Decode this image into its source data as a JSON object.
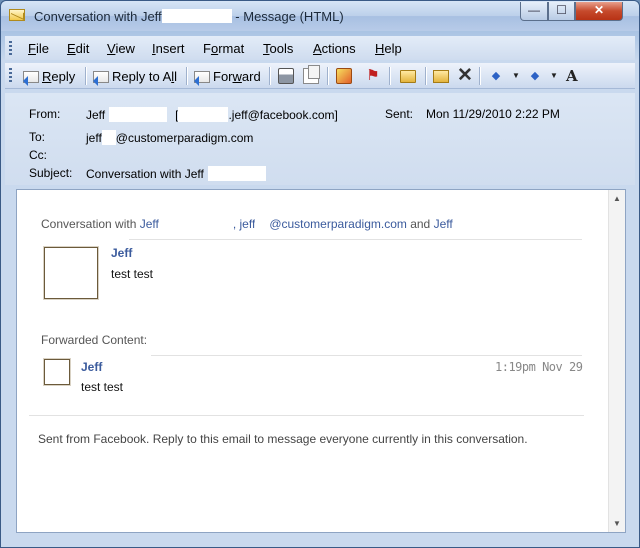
{
  "window": {
    "title_prefix": "Conversation with Jeff",
    "title_suffix": "- Message (HTML)",
    "min_label": "—",
    "max_label": "☐",
    "close_label": "✕"
  },
  "menu": {
    "items": [
      {
        "key": "F",
        "rest": "ile"
      },
      {
        "key": "E",
        "rest": "dit"
      },
      {
        "key": "V",
        "rest": "iew"
      },
      {
        "key": "I",
        "rest": "nsert"
      },
      {
        "key": "",
        "rest": "Format",
        "pre": "F",
        "u": "o",
        "post": "rmat"
      },
      {
        "key": "T",
        "rest": "ools"
      },
      {
        "key": "A",
        "rest": "ctions"
      },
      {
        "key": "H",
        "rest": "elp"
      }
    ]
  },
  "toolbar": {
    "reply_key": "R",
    "reply_rest": "eply",
    "reply_all_pre": "Reply to A",
    "reply_all_key": "l",
    "reply_all_post": "l",
    "forward_pre": "For",
    "forward_key": "w",
    "forward_post": "ard",
    "font_label": "A",
    "icons": [
      "reply-icon",
      "reply-all-icon",
      "forward-icon",
      "print-icon",
      "copy-icon",
      "categorize-icon",
      "flag-icon",
      "folder-icon",
      "move-icon",
      "delete-icon",
      "previous-item-icon",
      "next-item-icon",
      "font-size-icon"
    ]
  },
  "header": {
    "from_label": "From:",
    "from_name": "Jeff",
    "from_bracket": "[",
    "from_email_suffix": ".jeff@facebook.com]",
    "sent_label": "Sent:",
    "sent_value": "Mon 11/29/2010 2:22 PM",
    "to_label": "To:",
    "to_name": "jeff",
    "to_email_suffix": "@customerparadigm.com",
    "cc_label": "Cc:",
    "subject_label": "Subject:",
    "subject_value": "Conversation with Jeff"
  },
  "body": {
    "conv_prefix": "Conversation with ",
    "conv_name1": "Jeff",
    "conv_sep": ", jeff",
    "conv_email": "@customerparadigm.com",
    "conv_and": " and ",
    "conv_name2": "Jeff",
    "sender1": "Jeff",
    "message1": "test test",
    "forwarded_label": "Forwarded Content:",
    "sender2": "Jeff",
    "message2": "test test",
    "time2": "1:19pm Nov 29",
    "footer": "Sent from Facebook. Reply to this email to message everyone currently in this conversation."
  },
  "colors": {
    "link_blue": "#3b5b9d",
    "close_red": "#c64a2c",
    "chrome_blue": "#c9d9ee"
  }
}
